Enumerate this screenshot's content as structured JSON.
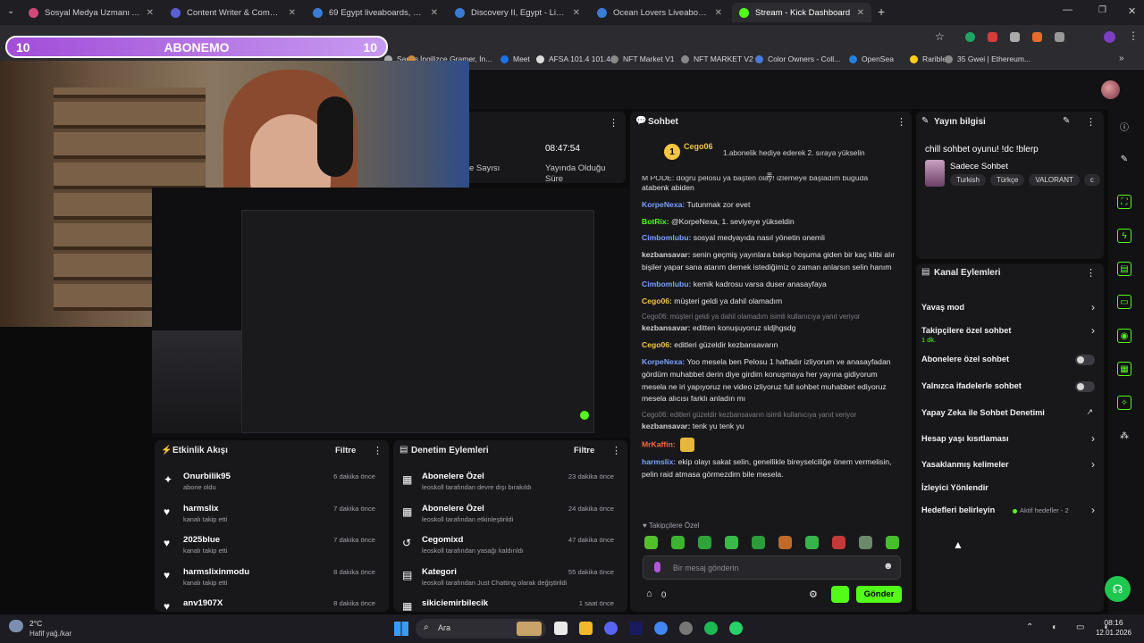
{
  "tabs": [
    {
      "label": "Sosyal Medya Uzmanı Arantyor",
      "color": "#d14a7a"
    },
    {
      "label": "Content Writer & Community",
      "color": "#5a5fd8"
    },
    {
      "label": "69 Egypt liveaboards, May 2026",
      "color": "#3a7bd5"
    },
    {
      "label": "Discovery II, Egypt - LiveAboard",
      "color": "#3a7bd5"
    },
    {
      "label": "Ocean Lovers Liveaboard, Egypt",
      "color": "#3a7bd5"
    },
    {
      "label": "Stream - Kick Dashboard",
      "color": "#53fc18"
    }
  ],
  "bookmarks": [
    "Şarjes",
    "İngilizce Gramer, İn...",
    "Meet",
    "AFSA 101.4 101.4",
    "NFT Market V1",
    "NFT MARKET V2",
    "Color Owners - Coll...",
    "OpenSea",
    "Rarible",
    "35 Gwei | Ethereum..."
  ],
  "overlay": {
    "left_num": "10",
    "title": "ABONEMO",
    "right_num": "10"
  },
  "stats": {
    "time": "08:47:54",
    "viewers_label": "e Sayısı",
    "uptime_label": "Yayında Olduğu Süre"
  },
  "chat": {
    "title": "Sohbet",
    "pinned_user": "Cego06",
    "pinned_text": "1.abonelik hediye ederek 2. sıraya yükselin",
    "lines": [
      {
        "user": "",
        "color": "#e4e4e7",
        "text": "atabenk abiden",
        "partial": "M PODE: doğru pelosu ya başten olay! izlemeye başladım buğuda"
      },
      {
        "user": "KorpeNexa:",
        "color": "#7aa2ff",
        "text": "Tutunmak zor evet"
      },
      {
        "user": "BotRix:",
        "color": "#53fc18",
        "text": "@KorpeNexa, 1. seviyeye yükseldin"
      },
      {
        "user": "Cimbomlubu:",
        "color": "#7aa2ff",
        "text": "sosyal medyayıda nasıl yönetin onemli"
      },
      {
        "user": "kezbansavar:",
        "color": "#d0d0d6",
        "text": "senin geçmiş yayınlara bakıp hoşuma giden bir kaç klibi alır bişiler yapar sana atarım demek istediğimiz o zaman anlarsın selin hanım"
      },
      {
        "user": "Cimbomlubu:",
        "color": "#7aa2ff",
        "text": "kemik kadrosu varsa duser anasayfaya"
      },
      {
        "user": "Cego06:",
        "color": "#f5c542",
        "text": "müşteri geldi ya dahil olamadım"
      },
      {
        "reply": "Cego06: müşteri geldi ya dahil olamadım isimli kullanıcıya yanıt veriyor"
      },
      {
        "user": "kezbansavar:",
        "color": "#d0d0d6",
        "text": "editten konuşuyoruz sldjhgsdg"
      },
      {
        "user": "Cego06:",
        "color": "#f5c542",
        "text": "editleri güzeldir kezbansavarın"
      },
      {
        "user": "KorpeNexa:",
        "color": "#7aa2ff",
        "text": "Yoo mesela ben Pelosu 1 haftadır izliyorum ve anasayfadan gördüm muhabbet derin diye girdim konuşmaya her yayına gidiyorum mesela ne iri yapıyoruz ne video izliyoruz full sohbet muhabbet ediyoruz mesela alıcısı farklı anladın mı"
      },
      {
        "reply": "Cego06: editleri güzeldir kezbansavarın isimli kullanıcıya yanıt veriyor"
      },
      {
        "user": "kezbansavar:",
        "color": "#d0d0d6",
        "text": "tenk yu tenk yu"
      },
      {
        "user": "MrKaffin:",
        "color": "#ff6a3d",
        "text": ""
      },
      {
        "user": "harmslix:",
        "color": "#7aa2ff",
        "text": "ekip olayı sakat selin, genellikle bireyselciliğe önem vermelisin, pelin raid atmasa görmezdim bile mesela."
      }
    ],
    "mode": "Takipçilere Özel",
    "placeholder": "Bir mesaj gönderin",
    "count": "0",
    "send": "Gönder"
  },
  "stream_info": {
    "header": "Yayın bilgisi",
    "title": "chill sohbet oyunu! !dc !blerp",
    "category": "Sadece Sohbet",
    "tags": [
      "Turkish",
      "Türkçe",
      "VALORANT",
      "c"
    ]
  },
  "channel_actions": {
    "header": "Kanal Eylemleri",
    "items": [
      {
        "label": "Yavaş mod",
        "kind": "chev"
      },
      {
        "label": "Takipçilere özel sohbet",
        "sub": "1 dk.",
        "kind": "chev"
      },
      {
        "label": "Abonelere özel sohbet",
        "kind": "toggle"
      },
      {
        "label": "Yalnızca ifadelerle sohbet",
        "kind": "toggle"
      },
      {
        "label": "Yapay Zeka ile Sohbet Denetimi",
        "kind": "ext"
      },
      {
        "label": "Hesap yaşı kısıtlaması",
        "kind": "chev"
      },
      {
        "label": "Yasaklanmış kelimeler",
        "kind": "chev"
      },
      {
        "label": "İzleyici Yönlendir",
        "kind": "none"
      },
      {
        "label": "Hedefleri belirleyin",
        "kind": "chev",
        "extra": "Aktif hedefler - 2"
      }
    ]
  },
  "activity": {
    "header": "Etkinlik Akışı",
    "filter": "Filtre",
    "items": [
      {
        "name": "Onurbilik95",
        "sub": "abone oldu",
        "time": "6 dakika önce",
        "icon": "✦"
      },
      {
        "name": "harmslix",
        "sub": "kanalı takip etti",
        "time": "7 dakika önce",
        "icon": "♥"
      },
      {
        "name": "2025blue",
        "sub": "kanalı takip etti",
        "time": "7 dakika önce",
        "icon": "♥"
      },
      {
        "name": "harmslixinmodu",
        "sub": "kanalı takip etti",
        "time": "8 dakika önce",
        "icon": "♥"
      },
      {
        "name": "anv1907X",
        "sub": "",
        "time": "8 dakika önce",
        "icon": "♥"
      }
    ]
  },
  "moderation": {
    "header": "Denetim Eylemleri",
    "filter": "Filtre",
    "items": [
      {
        "name": "Abonelere Özel",
        "sub": "leoskoll tarafından devre dışı bırakıldı",
        "time": "23 dakika önce",
        "icon": "▦"
      },
      {
        "name": "Abonelere Özel",
        "sub": "leoskoll tarafından etkinleştirildi",
        "time": "24 dakika önce",
        "icon": "▦"
      },
      {
        "name": "Cegomixd",
        "sub": "leoskoll tarafından yasağı kaldırıldı",
        "time": "47 dakika önce",
        "icon": "↺"
      },
      {
        "name": "Kategori",
        "sub": "leoskoll tarafından Just Chatting olarak değiştirildi",
        "time": "55 dakika önce",
        "icon": "▤"
      },
      {
        "name": "sikiciemirbilecik",
        "sub": "",
        "time": "1 saat önce",
        "icon": "▦"
      }
    ]
  },
  "taskbar": {
    "temp": "2°C",
    "weather": "Hafif yağ./kar",
    "search": "Ara",
    "time": "08:16",
    "date": "12.01.2026"
  },
  "colors": {
    "accent": "#53fc18",
    "bg": "#0b0b0c",
    "panel": "#18181b"
  }
}
